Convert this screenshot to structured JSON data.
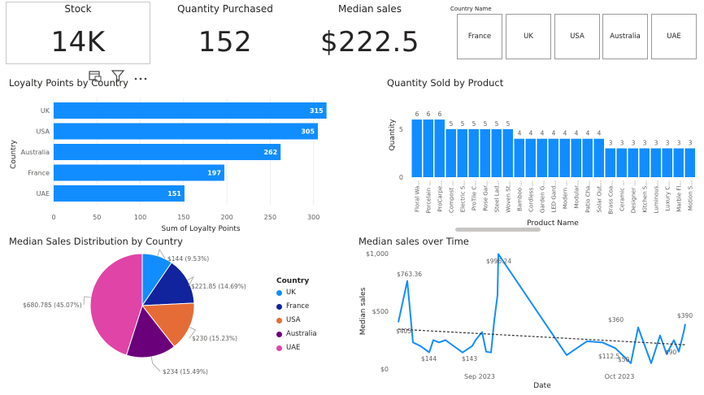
{
  "kpis": {
    "stock": {
      "title": "Stock",
      "value": "14K"
    },
    "quantity": {
      "title": "Quantity Purchased",
      "value": "152"
    },
    "median": {
      "title": "Median sales",
      "value": "$222.5"
    }
  },
  "slicer": {
    "title": "Country Name",
    "options": [
      "France",
      "UK",
      "USA",
      "Australia",
      "UAE"
    ]
  },
  "colors": {
    "accent": "#118DFF",
    "pie_uk": "#118DFF",
    "pie_france": "#12239E",
    "pie_usa": "#E66C37",
    "pie_australia": "#6B007B",
    "pie_uae": "#E044A7"
  },
  "toolbar_icons": [
    "focus-mode-icon",
    "filter-icon",
    "more-options-icon"
  ],
  "loyalty": {
    "title": "Loyalty Points by Country",
    "chart_data": {
      "type": "bar",
      "orientation": "horizontal",
      "categories": [
        "UK",
        "USA",
        "Australia",
        "France",
        "UAE"
      ],
      "values": [
        315,
        305,
        262,
        197,
        151
      ],
      "xlabel": "Sum of Loyalty Points",
      "ylabel": "Country",
      "xlim": [
        0,
        320
      ],
      "xticks": [
        0,
        50,
        100,
        150,
        200,
        250,
        300
      ]
    }
  },
  "product": {
    "title": "Quantity Sold by Product",
    "chart_data": {
      "type": "bar",
      "categories": [
        "Floral Wa...",
        "Porcelain ...",
        "ProCarpe...",
        "Compost ...",
        "Electric S...",
        "ProTile C...",
        "Rose Gar...",
        "Steel Lad...",
        "Woven St...",
        "Bamboo ...",
        "Cordless ...",
        "Garden G...",
        "LED Gard...",
        "Modern ...",
        "Modular...",
        "Patio Cha...",
        "Solar Out...",
        "Brass Coa...",
        "Ceramic ...",
        "Designer ...",
        "Kitchen S...",
        "Luminous...",
        "Luxury C...",
        "Marble Fl...",
        "Motion S..."
      ],
      "values": [
        6,
        6,
        6,
        5,
        5,
        5,
        5,
        5,
        5,
        4,
        4,
        4,
        4,
        4,
        4,
        4,
        4,
        3,
        3,
        3,
        3,
        3,
        3,
        3,
        3
      ],
      "xlabel": "Product Name",
      "ylabel": "Quantity",
      "ylim": [
        0,
        7
      ],
      "yticks": [
        0,
        5
      ]
    }
  },
  "pie": {
    "title": "Median Sales Distribution by Country",
    "legend_title": "Country",
    "chart_data": {
      "type": "pie",
      "slices": [
        {
          "label": "UK",
          "value": 144,
          "text": "$144 (9.53%)"
        },
        {
          "label": "France",
          "value": 221.85,
          "text": "$221.85 (14.69%)"
        },
        {
          "label": "USA",
          "value": 230,
          "text": "$230 (15.23%)"
        },
        {
          "label": "Australia",
          "value": 234,
          "text": "$234 (15.49%)"
        },
        {
          "label": "UAE",
          "value": 680.785,
          "text": "$680.785 (45.07%)"
        }
      ]
    }
  },
  "timeline": {
    "title": "Median sales over Time",
    "chart_data": {
      "type": "line",
      "xlabel": "Date",
      "ylabel": "Median sales",
      "x_ticks": [
        "Sep 2023",
        "Oct 2023"
      ],
      "y_ticks": [
        "$0",
        "$500",
        "$1,000"
      ],
      "ylim": [
        0,
        1000
      ],
      "trendline": true,
      "series": [
        {
          "values": [
            405,
            763.36,
            230,
            200,
            144,
            250,
            230,
            250,
            143,
            200,
            250,
            320,
            150,
            143,
            420,
            640,
            996.24,
            120,
            240,
            230,
            180,
            50,
            360,
            50,
            290,
            130,
            250,
            150,
            320,
            390
          ]
        }
      ],
      "data_labels": [
        "$405",
        "$763.36",
        "$144",
        "$143",
        "$996.24",
        "$360",
        "$390",
        "$112.5",
        "$90",
        "$50"
      ]
    }
  }
}
